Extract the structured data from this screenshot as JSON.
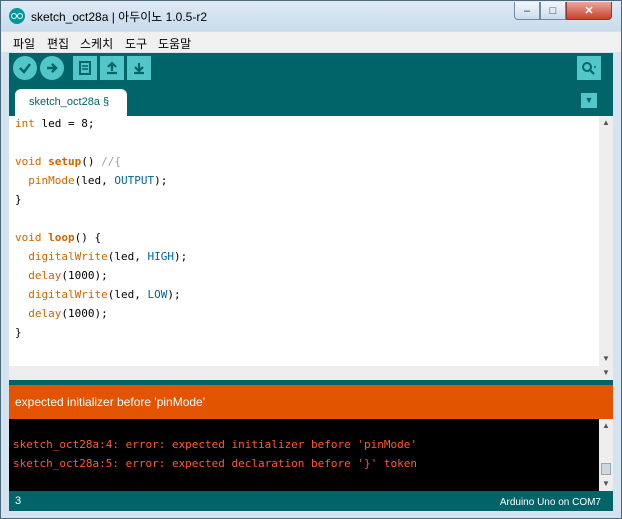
{
  "window": {
    "title": "sketch_oct28a | 아두이노 1.0.5-r2",
    "controls": {
      "minimize": "‒",
      "maximize": "□",
      "close": "✕"
    }
  },
  "menu": [
    "파일",
    "편집",
    "스케치",
    "도구",
    "도움말"
  ],
  "toolbar": {
    "buttons": [
      "verify-icon",
      "upload-icon",
      "new-icon",
      "open-icon",
      "save-icon"
    ],
    "serial_monitor": "serial-monitor-icon"
  },
  "tabs": [
    {
      "label": "sketch_oct28a §"
    }
  ],
  "code": {
    "l1": {
      "a": "int",
      "b": " led = 8;"
    },
    "l3": {
      "a": "void",
      "b": " ",
      "c": "setup",
      "d": "() ",
      "e": "//{"
    },
    "l4": {
      "a": "  ",
      "b": "pinMode",
      "c": "(led, ",
      "d": "OUTPUT",
      "e": ");"
    },
    "l5": {
      "a": "}"
    },
    "l7": {
      "a": "void",
      "b": " ",
      "c": "loop",
      "d": "() {"
    },
    "l8": {
      "a": "  ",
      "b": "digitalWrite",
      "c": "(led, ",
      "d": "HIGH",
      "e": ");"
    },
    "l9": {
      "a": "  ",
      "b": "delay",
      "c": "(1000);"
    },
    "l10": {
      "a": "  ",
      "b": "digitalWrite",
      "c": "(led, ",
      "d": "LOW",
      "e": ");"
    },
    "l11": {
      "a": "  ",
      "b": "delay",
      "c": "(1000);"
    },
    "l12": {
      "a": "}"
    }
  },
  "status": {
    "message": "expected initializer before 'pinMode'"
  },
  "console": {
    "lines": [
      "sketch_oct28a:4: error: expected initializer before 'pinMode'",
      "sketch_oct28a:5: error: expected declaration before '}' token"
    ]
  },
  "footer": {
    "line": "3",
    "board": "Arduino Uno on COM7"
  },
  "colors": {
    "teal": "#006468",
    "button": "#52c7c9",
    "error_bar": "#e35400",
    "console_text": "#ff5a2e"
  }
}
